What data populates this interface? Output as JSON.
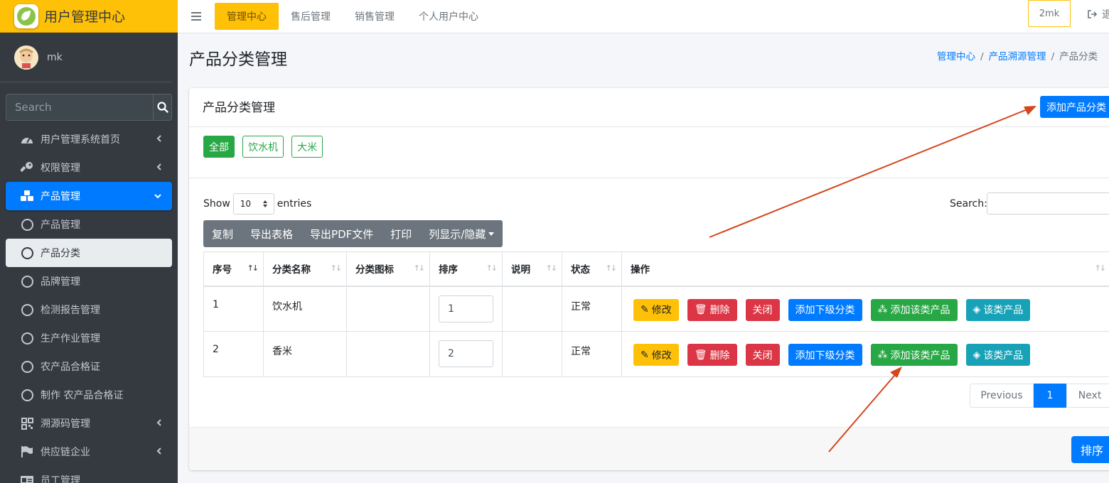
{
  "brand": {
    "title": "用户管理中心"
  },
  "user": {
    "name": "mk"
  },
  "sidebar": {
    "search_placeholder": "Search",
    "items": [
      {
        "label": "用户管理系统首页",
        "icon": "tachometer-icon"
      },
      {
        "label": "权限管理",
        "icon": "key-icon"
      },
      {
        "label": "产品管理",
        "icon": "cubes-icon"
      },
      {
        "label": "产品管理",
        "icon": "circle-icon"
      },
      {
        "label": "产品分类",
        "icon": "circle-icon"
      },
      {
        "label": "品牌管理",
        "icon": "circle-icon"
      },
      {
        "label": "检测报告管理",
        "icon": "circle-icon"
      },
      {
        "label": "生产作业管理",
        "icon": "circle-icon"
      },
      {
        "label": "农产品合格证",
        "icon": "circle-icon"
      },
      {
        "label": "制作 农产品合格证",
        "icon": "circle-icon"
      },
      {
        "label": "溯源码管理",
        "icon": "qrcode-icon"
      },
      {
        "label": "供应链企业",
        "icon": "flag-icon"
      },
      {
        "label": "员工管理",
        "icon": "id-card-icon"
      }
    ]
  },
  "topnav": {
    "links": [
      "管理中心",
      "售后管理",
      "销售管理",
      "个人用户中心"
    ],
    "user_box": "2mk",
    "logout": "退"
  },
  "page": {
    "title": "产品分类管理",
    "breadcrumb": [
      "管理中心",
      "产品溯源管理",
      "产品分类"
    ]
  },
  "card": {
    "title": "产品分类管理",
    "add_button": "添加产品分类",
    "filters": [
      "全部",
      "饮水机",
      "大米"
    ]
  },
  "datatable": {
    "show_label": "Show",
    "page_length": "10",
    "entries_label": "entries",
    "search_label": "Search:",
    "toolbar": [
      "复制",
      "导出表格",
      "导出PDF文件",
      "打印",
      "列显示/隐藏"
    ],
    "columns": [
      "序号",
      "分类名称",
      "分类图标",
      "排序",
      "说明",
      "状态",
      "操作"
    ],
    "rows": [
      {
        "id": "1",
        "name": "饮水机",
        "icon": "",
        "order": "1",
        "desc": "",
        "status": "正常"
      },
      {
        "id": "2",
        "name": "香米",
        "icon": "",
        "order": "2",
        "desc": "",
        "status": "正常"
      }
    ],
    "row_actions": [
      "修改",
      "删除",
      "关闭",
      "添加下级分类",
      "添加该类产品",
      "该类产品"
    ],
    "pagination": {
      "previous": "Previous",
      "current": "1",
      "next": "Next"
    }
  },
  "footer": {
    "sort_button": "排序"
  },
  "colors": {
    "accent": "#ffc107",
    "primary": "#007bff",
    "sidebar": "#343a40",
    "annotation_arrow": "#d4461c"
  }
}
